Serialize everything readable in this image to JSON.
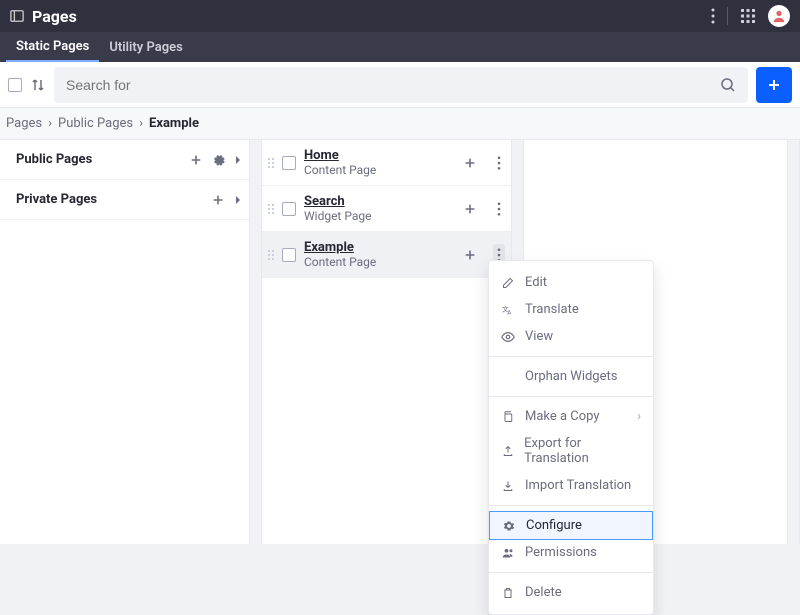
{
  "header": {
    "title": "Pages"
  },
  "tabs": {
    "static": "Static Pages",
    "utility": "Utility Pages",
    "active": "static"
  },
  "search": {
    "placeholder": "Search for"
  },
  "breadcrumb": {
    "items": [
      "Pages",
      "Public Pages"
    ],
    "current": "Example"
  },
  "sidebar": {
    "sections": [
      {
        "label": "Public Pages",
        "expandable": true,
        "hasPlus": true,
        "hasGear": true
      },
      {
        "label": "Private Pages",
        "expandable": true,
        "hasPlus": true,
        "hasGear": false
      }
    ]
  },
  "pages": [
    {
      "title": "Home",
      "subtitle": "Content Page",
      "selected": false
    },
    {
      "title": "Search",
      "subtitle": "Widget Page",
      "selected": false
    },
    {
      "title": "Example",
      "subtitle": "Content Page",
      "selected": true
    }
  ],
  "menu": {
    "items": [
      {
        "icon": "pencil",
        "label": "Edit"
      },
      {
        "icon": "translate",
        "label": "Translate"
      },
      {
        "icon": "eye",
        "label": "View"
      },
      {
        "sep": true
      },
      {
        "icon": null,
        "label": "Orphan Widgets"
      },
      {
        "sep": true
      },
      {
        "icon": "copy",
        "label": "Make a Copy",
        "submenu": true
      },
      {
        "icon": "export",
        "label": "Export for Translation"
      },
      {
        "icon": "import",
        "label": "Import Translation"
      },
      {
        "sep": true
      },
      {
        "icon": "gear",
        "label": "Configure",
        "highlight": true
      },
      {
        "icon": "users",
        "label": "Permissions"
      },
      {
        "sep": true
      },
      {
        "icon": "trash",
        "label": "Delete"
      }
    ]
  }
}
